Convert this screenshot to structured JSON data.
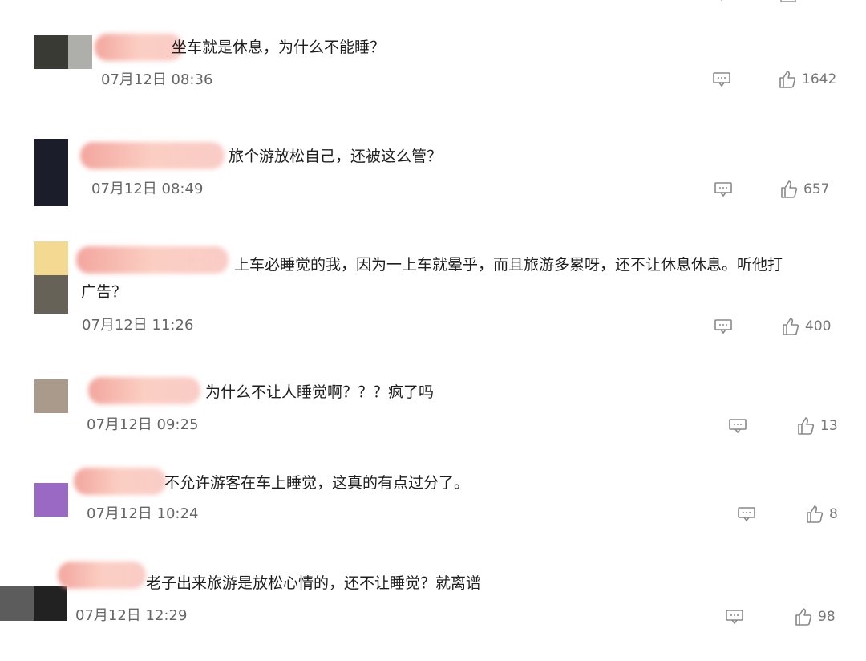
{
  "comments": [
    {
      "text": "坐车就是休息，为什么不能睡？",
      "time": "07月12日 08:36",
      "likes": "1642",
      "avatar_colors": [
        "#3a3a34",
        "#aeaeaa"
      ]
    },
    {
      "text": "旅个游放松自己，还被这么管？",
      "time": "07月12日 08:49",
      "likes": "657",
      "avatar_colors": [
        "#1b1d2a"
      ]
    },
    {
      "text_line1": "上车必睡觉的我，因为一上车就晕乎，而且旅游多累呀，还不让休息休息。听他打",
      "text_line2": "广告？",
      "time": "07月12日 11:26",
      "likes": "400",
      "avatar_colors": [
        "#f3d992",
        "#666257"
      ]
    },
    {
      "text": "为什么不让人睡觉啊？？？疯了吗",
      "time": "07月12日 09:25",
      "likes": "13",
      "avatar_colors": [
        "#a99a8c"
      ]
    },
    {
      "text": "不允许游客在车上睡觉，这真的有点过分了。",
      "time": "07月12日 10:24",
      "likes": "8",
      "avatar_colors": [
        "#9a69c4"
      ]
    },
    {
      "text": "老子出来旅游是放松心情的，还不让睡觉？就离谱",
      "time": "07月12日 12:29",
      "likes": "98",
      "avatar_colors": [
        "#5c5c5c",
        "#222222"
      ]
    }
  ],
  "icons": {
    "reply": "reply-comment-icon",
    "like": "thumbs-up-icon"
  }
}
